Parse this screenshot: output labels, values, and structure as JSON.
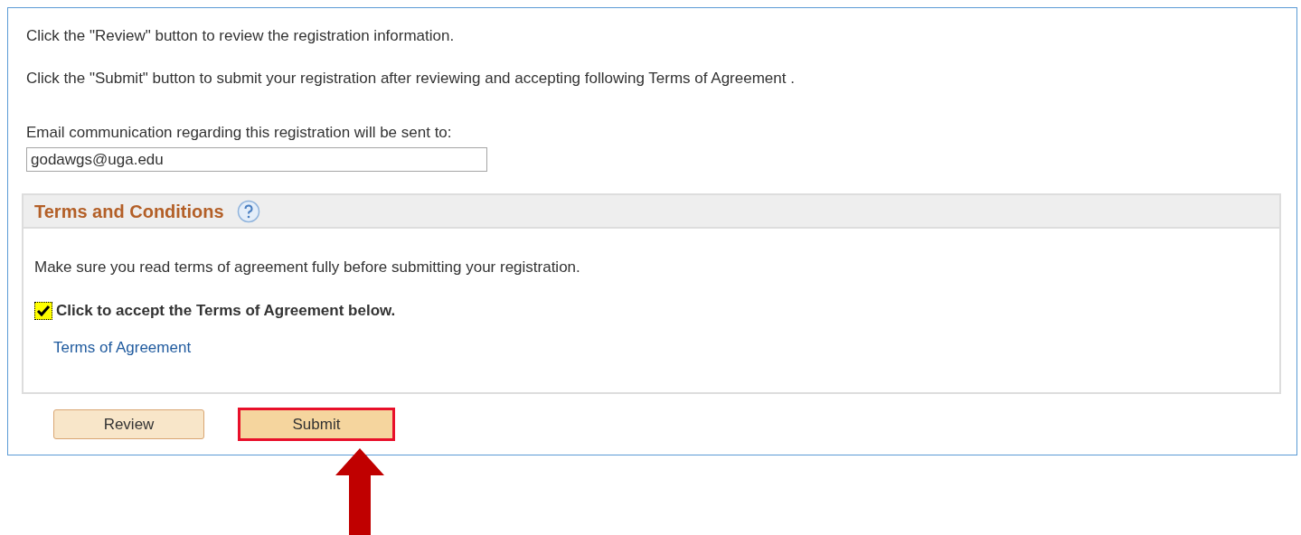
{
  "instructions": [
    "Click the \"Review\" button to review the registration information.",
    "Click the \"Submit\" button to submit your registration after reviewing and accepting following Terms of Agreement ."
  ],
  "email": {
    "label": "Email communication regarding this registration will be sent to:",
    "value": "godawgs@uga.edu"
  },
  "terms_panel": {
    "title": "Terms and Conditions",
    "message": "Make sure you read terms of agreement fully before submitting your registration.",
    "accept": {
      "label": "Click to accept the Terms of Agreement below.",
      "checked": true
    },
    "link": "Terms of Agreement"
  },
  "buttons": [
    {
      "label": "Review",
      "highlighted": false
    },
    {
      "label": "Submit",
      "highlighted": true
    }
  ]
}
